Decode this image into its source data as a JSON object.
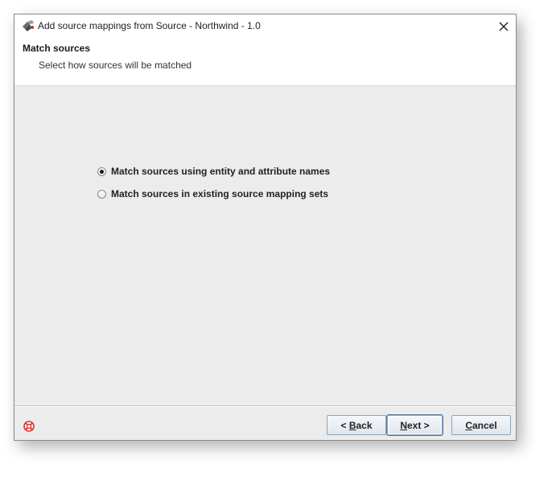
{
  "window": {
    "title": "Add source mappings from Source - Northwind - 1.0"
  },
  "header": {
    "title": "Match sources",
    "subtitle": "Select how sources will be matched"
  },
  "options": [
    {
      "label": "Match sources using entity and attribute names",
      "selected": true
    },
    {
      "label": "Match sources in existing source mapping sets",
      "selected": false
    }
  ],
  "buttons": {
    "back": {
      "prefix": "< ",
      "mnemonic": "B",
      "rest": "ack"
    },
    "next": {
      "prefix": "",
      "mnemonic": "N",
      "rest": "ext >"
    },
    "cancel": {
      "prefix": "",
      "mnemonic": "C",
      "rest": "ancel"
    }
  },
  "icons": {
    "app": "app-icon",
    "close": "close-icon",
    "help": "help-icon"
  },
  "colors": {
    "dialog_bg": "#ececec",
    "header_bg": "#ffffff",
    "button_border": "#8fa3b8",
    "help_red": "#d9302c"
  }
}
